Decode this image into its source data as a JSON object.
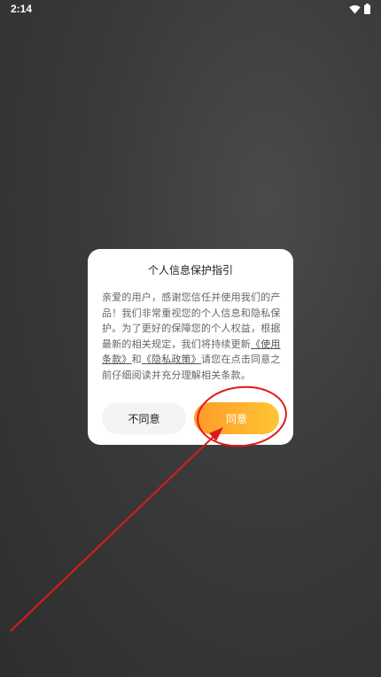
{
  "status_bar": {
    "time": "2:14",
    "icons": [
      "wifi-icon",
      "battery-icon"
    ]
  },
  "dialog": {
    "title": "个人信息保护指引",
    "body": {
      "part1": "亲爱的用户，感谢您信任并使用我们的产品！我们非常重视您的个人信息和隐私保护。为了更好的保障您的个人权益，根据最新的相关规定，我们将持续更新",
      "terms_link": "《使用条款》",
      "and_text": "和",
      "privacy_link": "《隐私政策》",
      "part2": "请您在点击同意之前仔细阅读并充分理解相关条款。"
    },
    "disagree_label": "不同意",
    "agree_label": "同意"
  },
  "colors": {
    "agree_gradient_start": "#ff9b2a",
    "agree_gradient_end": "#ffc533",
    "annotation": "#e01a1a"
  }
}
